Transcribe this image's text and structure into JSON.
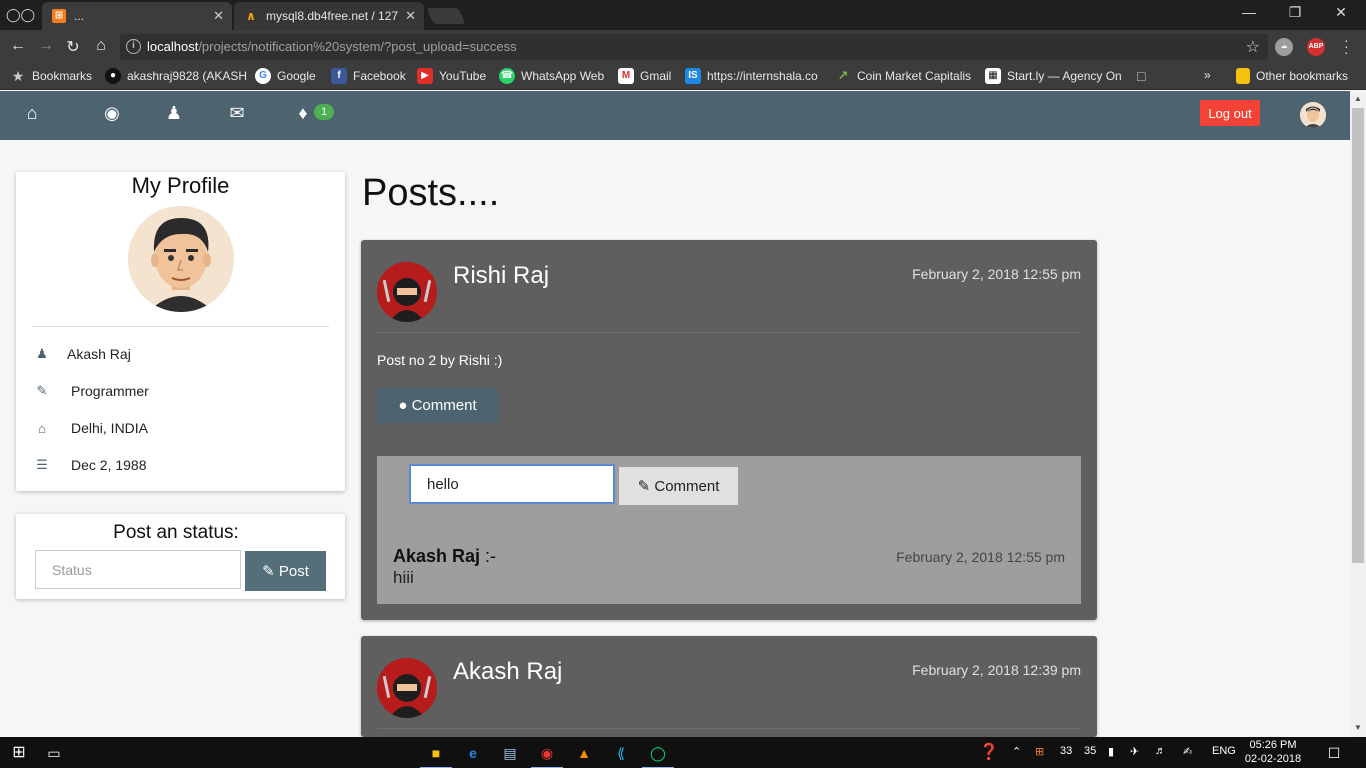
{
  "browser": {
    "tabs": [
      {
        "title": "...",
        "favicon": "xampp-icon",
        "active": true
      },
      {
        "title": "mysql8.db4free.net / 127",
        "favicon": "phpmyadmin-icon",
        "active": false
      }
    ],
    "address": {
      "host": "localhost",
      "path": "/projects/notification%20system/?post_upload=success"
    },
    "bookmarks": [
      {
        "label": "Bookmarks",
        "icon": "star-icon"
      },
      {
        "label": "akashraj9828 (AKASH",
        "icon": "github-icon"
      },
      {
        "label": "Google",
        "icon": "google-icon"
      },
      {
        "label": "Facebook",
        "icon": "facebook-icon"
      },
      {
        "label": "YouTube",
        "icon": "youtube-icon"
      },
      {
        "label": "WhatsApp Web",
        "icon": "whatsapp-icon"
      },
      {
        "label": "Gmail",
        "icon": "gmail-icon"
      },
      {
        "label": "https://internshala.co",
        "icon": "internshala-icon"
      },
      {
        "label": "Coin Market Capitalis",
        "icon": "chart-icon"
      },
      {
        "label": "Start.ly — Agency On",
        "icon": "startly-icon"
      }
    ],
    "other_bookmarks": "Other bookmarks",
    "overflow": "»"
  },
  "nav": {
    "notification_count": "1",
    "logout_label": "Log out"
  },
  "profile": {
    "title": "My Profile",
    "name": "Akash Raj",
    "occupation": "Programmer",
    "location": "Delhi, INDIA",
    "birthday": "Dec 2, 1988"
  },
  "status_form": {
    "title": "Post an status:",
    "placeholder": "Status",
    "button": "Post"
  },
  "posts_heading": "Posts....",
  "posts": [
    {
      "author": "Rishi Raj",
      "date": "February 2, 2018 12:55 pm",
      "text": "Post no 2 by Rishi :)",
      "comment_button": "Comment",
      "comment_input_value": "hello",
      "comment_submit": "Comment",
      "comments": [
        {
          "author": "Akash Raj",
          "suffix": " :-",
          "text": "hiii",
          "date": "February 2, 2018 12:55 pm"
        }
      ]
    },
    {
      "author": "Akash Raj",
      "date": "February 2, 2018 12:39 pm"
    }
  ],
  "taskbar": {
    "tray_numbers": [
      "33",
      "35"
    ],
    "language": "ENG",
    "time": "05:26 PM",
    "date": "02-02-2018"
  }
}
